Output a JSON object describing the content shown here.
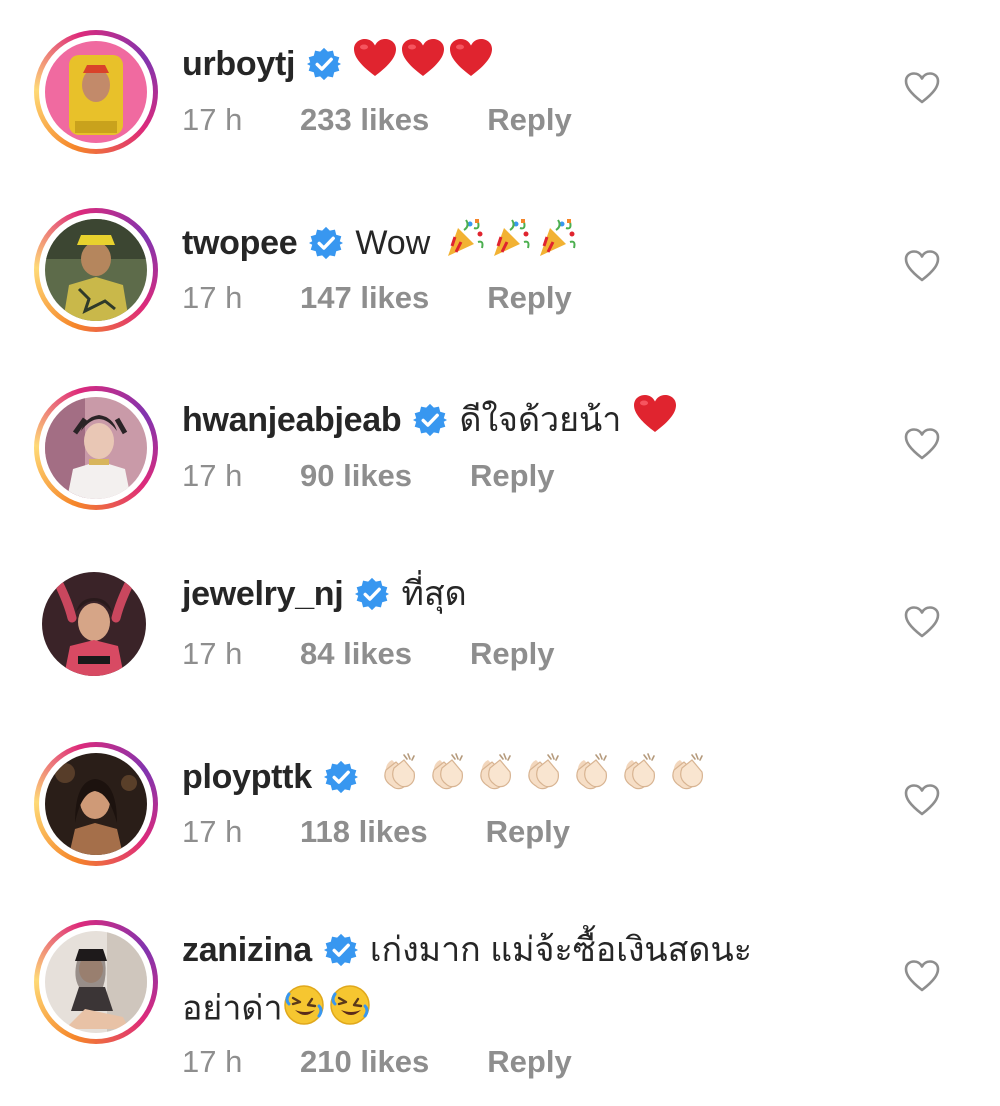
{
  "comments": [
    {
      "username": "urboytj",
      "text": "",
      "emoji": "heart",
      "emoji_count": 3,
      "time": "17 h",
      "likes": "233 likes",
      "reply": "Reply",
      "avatar_colors": [
        "#e8c12a",
        "#f06aa0"
      ]
    },
    {
      "username": "twopee",
      "text": "Wow",
      "emoji": "party-popper",
      "emoji_count": 3,
      "time": "17 h",
      "likes": "147 likes",
      "reply": "Reply",
      "avatar_colors": [
        "#2f3a2a",
        "#c9b84a"
      ]
    },
    {
      "username": "hwanjeabjeab",
      "text": "ดีใจด้วยน้า",
      "emoji": "heart",
      "emoji_count": 1,
      "time": "17 h",
      "likes": "90 likes",
      "reply": "Reply",
      "avatar_colors": [
        "#e9d7d9",
        "#b5838f"
      ]
    },
    {
      "username": "jewelry_nj",
      "text": "ที่สุด",
      "emoji": "",
      "emoji_count": 0,
      "time": "17 h",
      "likes": "84 likes",
      "reply": "Reply",
      "avatar_colors": [
        "#3a2328",
        "#d84a63"
      ]
    },
    {
      "username": "ploypttk",
      "text": "",
      "emoji": "clapping-hands",
      "emoji_count": 7,
      "time": "17 h",
      "likes": "118 likes",
      "reply": "Reply",
      "avatar_colors": [
        "#2a1e18",
        "#a56f4a"
      ]
    },
    {
      "username": "zanizina",
      "text": "เก่งมาก แม่จ้ะซื้อเงินสดนะ",
      "text_line2": "อย่าด่า",
      "emoji": "rolling-laughing",
      "emoji_count": 2,
      "time": "17 h",
      "likes": "210 likes",
      "reply": "Reply",
      "avatar_colors": [
        "#d9d2cb",
        "#3b3536"
      ]
    }
  ],
  "colors": {
    "username": "#262626",
    "meta": "#8e8e8e",
    "verified": "#3897f0",
    "heart_emoji": "#e0242f",
    "like_icon": "#8e8e8e"
  },
  "icons": {
    "verified": "verified-badge-icon",
    "like": "heart-outline-icon"
  }
}
